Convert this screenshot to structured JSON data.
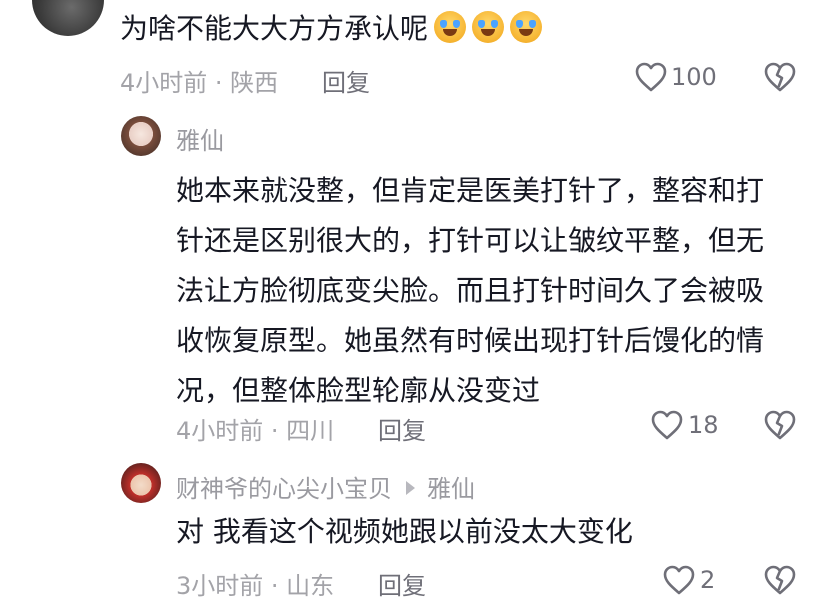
{
  "top_comment": {
    "text": "为啥不能大大方方承认呢",
    "emojis": [
      "sad-tears-emoji",
      "sad-tears-emoji",
      "sad-tears-emoji"
    ],
    "meta": "4小时前 · 陕西",
    "reply_label": "回复",
    "like_count": "100"
  },
  "reply_1": {
    "author": "雅仙",
    "lines": [
      "她本来就没整，但肯定是医美打针了，整容和打",
      "针还是区别很大的，打针可以让皱纹平整，但无",
      "法让方脸彻底变尖脸。而且打针时间久了会被吸",
      "收恢复原型。她虽然有时候出现打针后馒化的情",
      "况，但整体脸型轮廓从没变过"
    ],
    "meta": "4小时前 · 四川",
    "reply_label": "回复",
    "like_count": "18"
  },
  "reply_2": {
    "author": "财神爷的心尖小宝贝",
    "reply_to": "雅仙",
    "text": "对  我看这个视频她跟以前没太大变化",
    "meta": "3小时前 · 山东",
    "reply_label": "回复",
    "like_count": "2"
  },
  "colors": {
    "text": "#161823",
    "meta": "#a3a3a8",
    "secondary": "#6f6f78"
  }
}
